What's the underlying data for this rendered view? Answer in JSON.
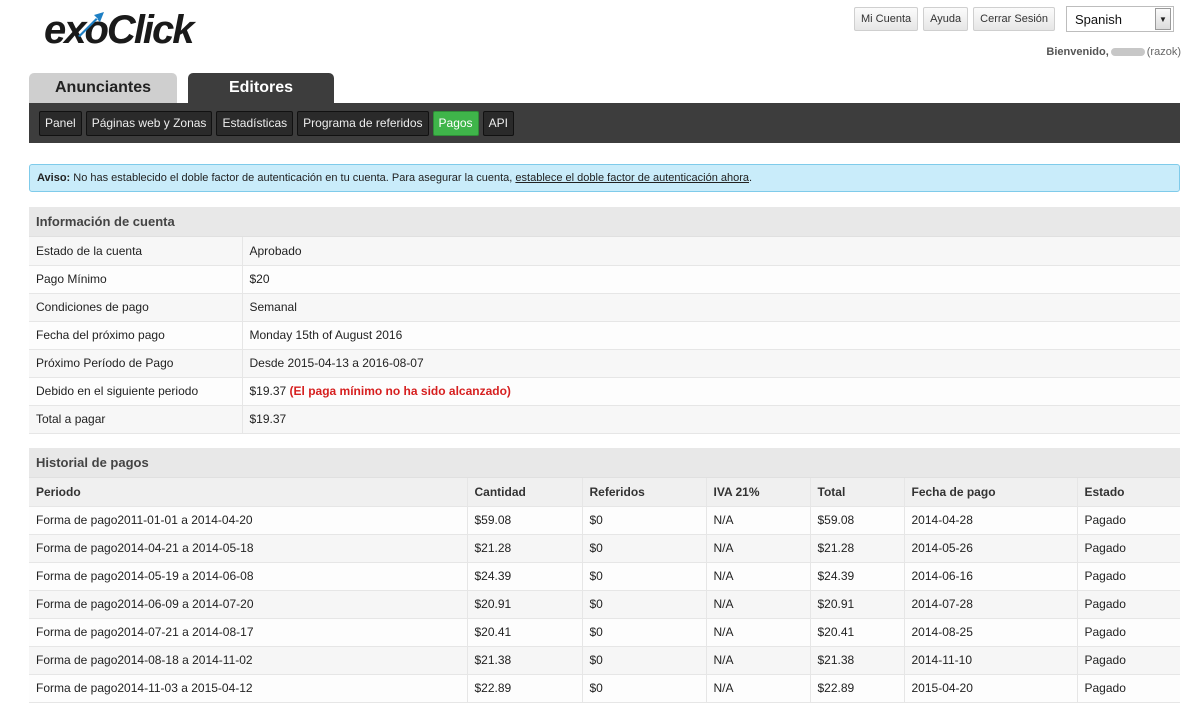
{
  "header": {
    "logo_text": "exoClick",
    "buttons": [
      "Mi Cuenta",
      "Ayuda",
      "Cerrar Sesión"
    ],
    "language": "Spanish",
    "welcome_label": "Bienvenido,",
    "welcome_user": "(razok)"
  },
  "section_tabs": [
    "Anunciantes",
    "Editores"
  ],
  "subnav": [
    "Panel",
    "Páginas web y Zonas",
    "Estadísticas",
    "Programa de referidos",
    "Pagos",
    "API"
  ],
  "alert": {
    "label": "Aviso:",
    "text": " No has establecido el doble factor de autenticación en tu cuenta. Para asegurar la cuenta, ",
    "link": "establece el doble factor de autenticación ahora",
    "end": "."
  },
  "account_info": {
    "title": "Información de cuenta",
    "rows": [
      {
        "label": "Estado de la cuenta",
        "value": "Aprobado"
      },
      {
        "label": "Pago Mínimo",
        "value": "$20"
      },
      {
        "label": "Condiciones de pago",
        "value": "Semanal"
      },
      {
        "label": "Fecha del próximo pago",
        "value": "Monday 15th of August 2016"
      },
      {
        "label": "Próximo Período de Pago",
        "value": "Desde 2015-04-13 a 2016-08-07"
      },
      {
        "label": "Debido en el siguiente periodo",
        "value": "$19.37",
        "warning": "(El paga mínimo no ha sido alcanzado)"
      },
      {
        "label": "Total a pagar",
        "value": "$19.37"
      }
    ]
  },
  "payment_history": {
    "title": "Historial de pagos",
    "columns": [
      "Periodo",
      "Cantidad",
      "Referidos",
      "IVA 21%",
      "Total",
      "Fecha de pago",
      "Estado"
    ],
    "rows": [
      [
        "Forma de pago2011-01-01 a 2014-04-20",
        "$59.08",
        "$0",
        "N/A",
        "$59.08",
        "2014-04-28",
        "Pagado"
      ],
      [
        "Forma de pago2014-04-21 a 2014-05-18",
        "$21.28",
        "$0",
        "N/A",
        "$21.28",
        "2014-05-26",
        "Pagado"
      ],
      [
        "Forma de pago2014-05-19 a 2014-06-08",
        "$24.39",
        "$0",
        "N/A",
        "$24.39",
        "2014-06-16",
        "Pagado"
      ],
      [
        "Forma de pago2014-06-09 a 2014-07-20",
        "$20.91",
        "$0",
        "N/A",
        "$20.91",
        "2014-07-28",
        "Pagado"
      ],
      [
        "Forma de pago2014-07-21 a 2014-08-17",
        "$20.41",
        "$0",
        "N/A",
        "$20.41",
        "2014-08-25",
        "Pagado"
      ],
      [
        "Forma de pago2014-08-18 a 2014-11-02",
        "$21.38",
        "$0",
        "N/A",
        "$21.38",
        "2014-11-10",
        "Pagado"
      ],
      [
        "Forma de pago2014-11-03 a 2015-04-12",
        "$22.89",
        "$0",
        "N/A",
        "$22.89",
        "2015-04-20",
        "Pagado"
      ]
    ]
  },
  "colors": {
    "nav_bg": "#3d3d3d",
    "active_tab": "#3fb54a",
    "alert_bg": "#c9ecfa",
    "warning_text": "#d61f1f",
    "logo_blue": "#1d7fc4"
  }
}
